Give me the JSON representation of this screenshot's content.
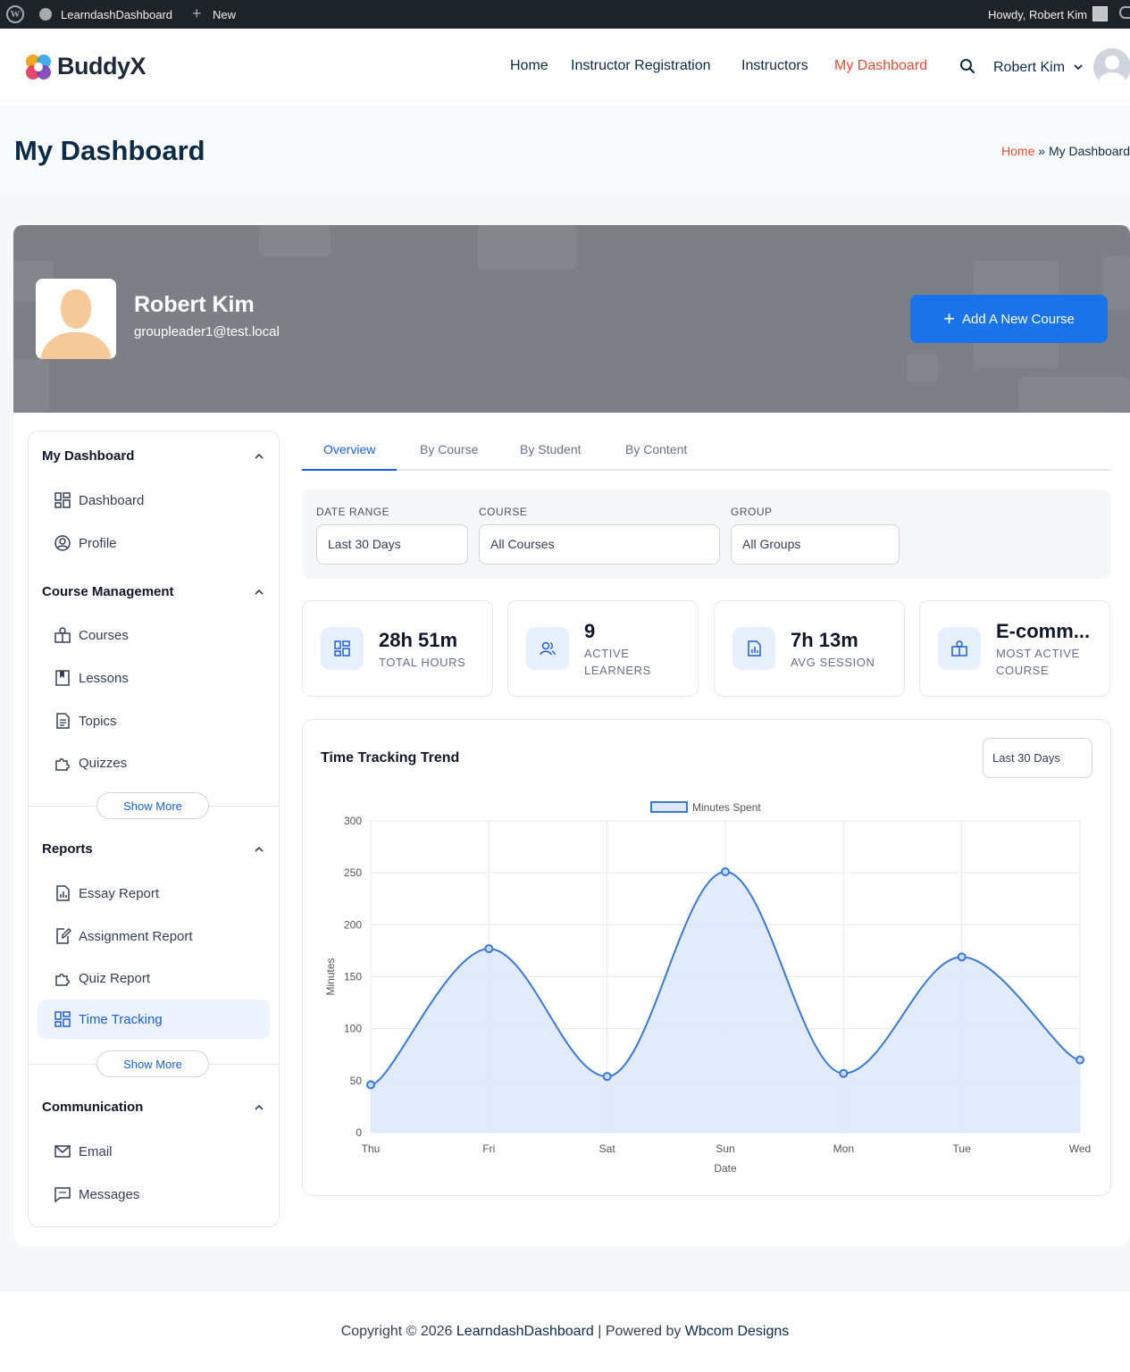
{
  "adminbar": {
    "site_name": "LearndashDashboard",
    "new_label": "New",
    "howdy": "Howdy, Robert Kim"
  },
  "header": {
    "brand": "BuddyX",
    "nav": [
      "Home",
      "Instructor Registration",
      "Instructors",
      "My Dashboard"
    ],
    "active_nav": "My Dashboard",
    "user_name": "Robert Kim"
  },
  "page": {
    "title": "My Dashboard",
    "breadcrumb_home": "Home",
    "breadcrumb_sep": "»",
    "breadcrumb_current": "My Dashboard"
  },
  "profile": {
    "name": "Robert Kim",
    "email": "groupleader1@test.local",
    "add_course_label": "Add A New Course"
  },
  "sidebar": {
    "sections": [
      {
        "title": "My Dashboard",
        "items": [
          {
            "label": "Dashboard",
            "icon": "grid-icon"
          },
          {
            "label": "Profile",
            "icon": "user-circle-icon"
          }
        ]
      },
      {
        "title": "Course Management",
        "items": [
          {
            "label": "Courses",
            "icon": "course-icon"
          },
          {
            "label": "Lessons",
            "icon": "bookmark-icon"
          },
          {
            "label": "Topics",
            "icon": "document-icon"
          },
          {
            "label": "Quizzes",
            "icon": "puzzle-icon"
          }
        ],
        "show_more": "Show More"
      },
      {
        "title": "Reports",
        "items": [
          {
            "label": "Essay Report",
            "icon": "chart-doc-icon"
          },
          {
            "label": "Assignment Report",
            "icon": "edit-doc-icon"
          },
          {
            "label": "Quiz Report",
            "icon": "puzzle-icon"
          },
          {
            "label": "Time Tracking",
            "icon": "grid-icon",
            "active": true
          }
        ],
        "show_more": "Show More"
      },
      {
        "title": "Communication",
        "items": [
          {
            "label": "Email",
            "icon": "mail-icon"
          },
          {
            "label": "Messages",
            "icon": "message-icon"
          }
        ]
      }
    ]
  },
  "tabs": [
    "Overview",
    "By Course",
    "By Student",
    "By Content"
  ],
  "active_tab": "Overview",
  "filters": {
    "date_range": {
      "label": "DATE RANGE",
      "value": "Last 30 Days"
    },
    "course": {
      "label": "COURSE",
      "value": "All Courses"
    },
    "group": {
      "label": "GROUP",
      "value": "All Groups"
    }
  },
  "stats": [
    {
      "value": "28h 51m",
      "label": "TOTAL HOURS",
      "icon": "grid-icon"
    },
    {
      "value": "9",
      "label": "ACTIVE LEARNERS",
      "icon": "users-icon"
    },
    {
      "value": "7h 13m",
      "label": "AVG SESSION",
      "icon": "report-icon"
    },
    {
      "value": "E-comm...",
      "label": "MOST ACTIVE COURSE",
      "icon": "course-icon"
    }
  ],
  "chart_card": {
    "title": "Time Tracking Trend",
    "range_select": "Last 30 Days"
  },
  "chart_data": {
    "type": "area",
    "x": [
      "Thu",
      "Fri",
      "Sat",
      "Sun",
      "Mon",
      "Tue",
      "Wed"
    ],
    "series": [
      {
        "name": "Minutes Spent",
        "values": [
          46,
          177,
          54,
          251,
          57,
          169,
          70
        ]
      }
    ],
    "xlabel": "Date",
    "ylabel": "Minutes",
    "ylim": [
      0,
      300
    ],
    "yticks": [
      0,
      50,
      100,
      150,
      200,
      250,
      300
    ],
    "grid": true,
    "legend": "top-center",
    "colors": {
      "line": "#3a78d8",
      "fill": "#dce8fb"
    }
  },
  "footer": {
    "prefix": "Copyright © 2026",
    "site": "LearndashDashboard",
    "mid": "| Powered by",
    "company": "Wbcom Designs"
  },
  "colors": {
    "accent": "#1a73e8",
    "active_nav": "#e24d38",
    "dark": "#0d2b45"
  }
}
